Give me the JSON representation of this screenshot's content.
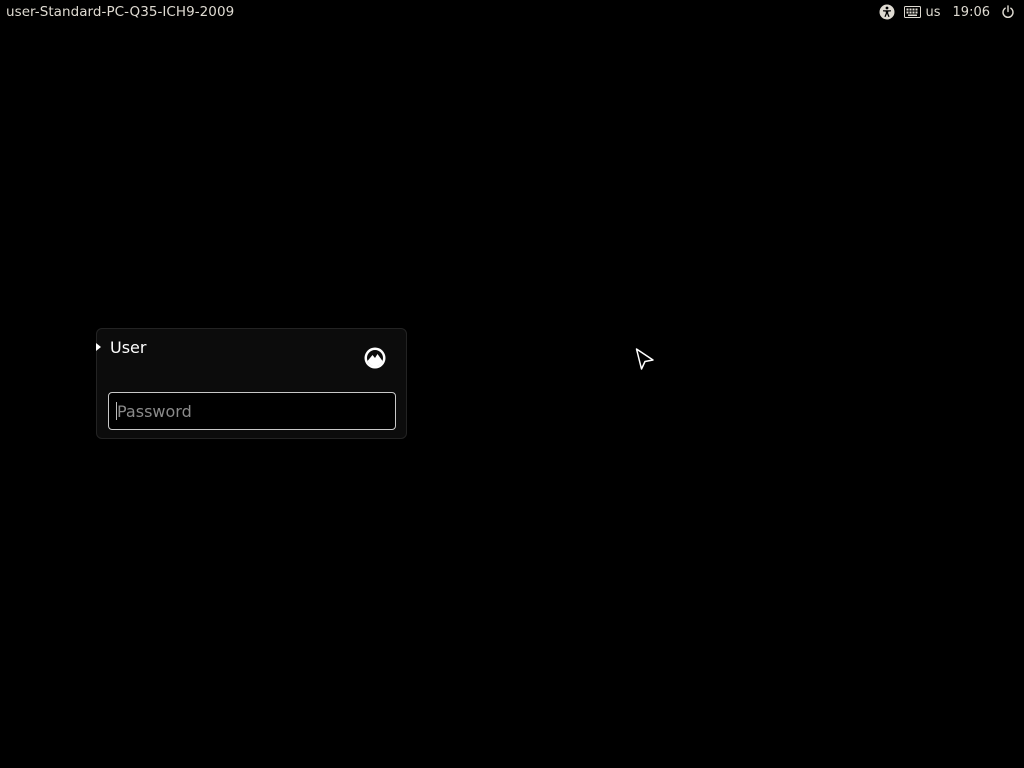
{
  "top_panel": {
    "hostname": "user-Standard-PC-Q35-ICH9-2009",
    "indicators": {
      "accessibility_icon": "accessibility-icon",
      "keyboard_icon": "keyboard-icon",
      "layout": "us",
      "clock": "19:06",
      "power_icon": "power-icon"
    }
  },
  "login": {
    "user_name": "User",
    "session_icon": "session-icon",
    "password": {
      "value": "",
      "placeholder": "Password"
    }
  },
  "colors": {
    "background": "#000000",
    "panel_text": "#dfdbd2",
    "box_background": "#0c0c0c",
    "field_border": "#c8c8c8"
  }
}
